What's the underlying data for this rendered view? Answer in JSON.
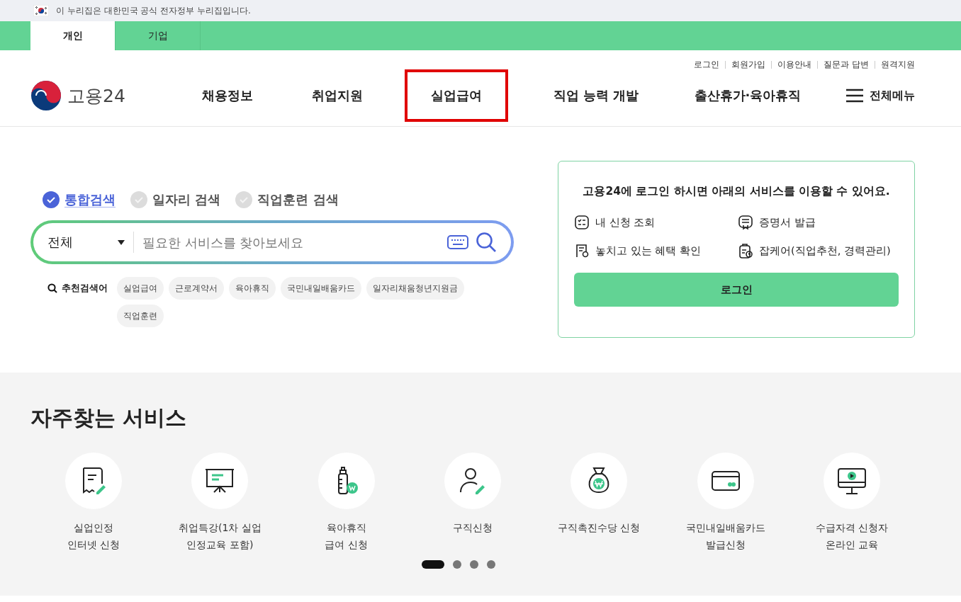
{
  "gov_banner": {
    "text": "이 누리집은 대한민국 공식 전자정부 누리집입니다."
  },
  "audience_tabs": [
    {
      "label": "개인",
      "selected": true
    },
    {
      "label": "기업",
      "selected": false
    }
  ],
  "util_links": [
    "로그인",
    "회원가입",
    "이용안내",
    "질문과 답변",
    "원격지원"
  ],
  "logo": {
    "text": "고용24"
  },
  "nav": [
    {
      "label": "채용정보",
      "highlighted": false
    },
    {
      "label": "취업지원",
      "highlighted": false
    },
    {
      "label": "실업급여",
      "highlighted": true
    },
    {
      "label": "직업 능력 개발",
      "highlighted": false
    },
    {
      "label": "출산휴가·육아휴직",
      "highlighted": false
    }
  ],
  "all_menu": {
    "label": "전체메뉴"
  },
  "search": {
    "tabs": [
      {
        "label": "통합검색",
        "selected": true
      },
      {
        "label": "일자리 검색",
        "selected": false
      },
      {
        "label": "직업훈련 검색",
        "selected": false
      }
    ],
    "category": "전체",
    "placeholder": "필요한 서비스를 찾아보세요",
    "recommended_label": "추천검색어",
    "keywords": [
      "실업급여",
      "근로계약서",
      "육아휴직",
      "국민내일배움카드",
      "일자리채움청년지원금",
      "직업훈련"
    ]
  },
  "login_card": {
    "title": "고용24에 **로그인** 하시면 아래의 서비스를 이용할 수 있어요.",
    "services": [
      "내 신청 조회",
      "증명서 발급",
      "놓치고 있는 혜택 확인",
      "잡케어(직업추천, 경력관리)"
    ],
    "button": "로그인"
  },
  "frequent_services": {
    "title": "자주찾는 서비스",
    "items": [
      {
        "label": "실업인정\n인터넷 신청"
      },
      {
        "label": "취업특강(1차 실업\n인정교육 포함)"
      },
      {
        "label": "육아휴직\n급여 신청"
      },
      {
        "label": "구직신청"
      },
      {
        "label": "구직촉진수당 신청"
      },
      {
        "label": "국민내일배움카드\n발급신청"
      },
      {
        "label": "수급자격 신청자\n온라인 교육"
      }
    ],
    "pages": [
      {
        "selected": true
      },
      {
        "selected": false
      },
      {
        "selected": false
      },
      {
        "selected": false
      }
    ]
  }
}
